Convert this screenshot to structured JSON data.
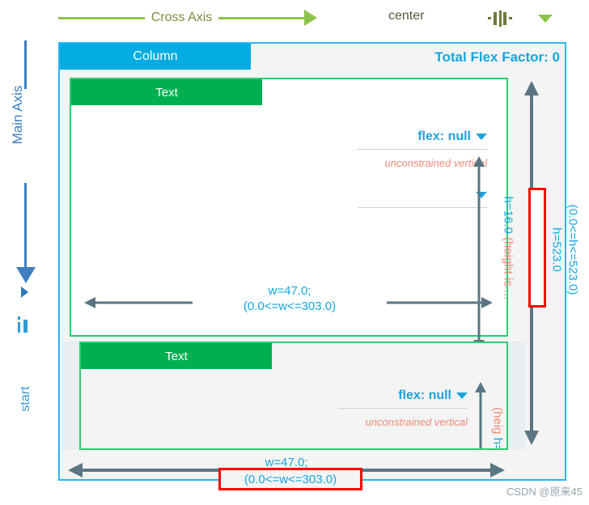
{
  "colors": {
    "cross_axis_green": "#8BC34A",
    "main_axis_blue": "#3F7FC1",
    "column_cyan": "#00ACE1",
    "text_green": "#00B050",
    "measure_blue": "#16A6DE",
    "constraint_red": "#FF0000",
    "unconstrained_orange": "#F08A76",
    "arrow_gray": "#5A7684"
  },
  "cross_axis": {
    "label": "Cross Axis",
    "value": "center",
    "align_icon": "align-center-horizontal-icon",
    "dropdown_icon": "chevron-down-icon"
  },
  "main_axis": {
    "label": "Main Axis",
    "value": "start",
    "align_icon": "align-start-vertical-icon",
    "dropdown_icon": "chevron-right-icon",
    "arrow_icon": "arrow-down-icon"
  },
  "column": {
    "tab_label": "Column",
    "total_flex_factor": "Total Flex Factor: 0",
    "height_value": "h=523.0",
    "height_constraint": "(0.0<=h<=523.0)",
    "width_value": "w=47.0;",
    "width_constraint": "(0.0<=w<=303.0)"
  },
  "children": [
    {
      "tab_label": "Text",
      "flex_label": "flex: null",
      "flex_caret_icon": "chevron-down-icon",
      "fit_caret_icon": "chevron-down-icon",
      "unconstrained_note": "unconstrained vertical",
      "height_value": "h=16.0",
      "height_note": "(height is ...",
      "width_value": "w=47.0;",
      "width_constraint": "(0.0<=w<=303.0)"
    },
    {
      "tab_label": "Text",
      "flex_label": "flex: null",
      "flex_caret_icon": "chevron-down-icon",
      "unconstrained_note": "unconstrained vertical",
      "height_value": "h=",
      "height_note": "(heig"
    }
  ],
  "watermark": "CSDN @原来45"
}
